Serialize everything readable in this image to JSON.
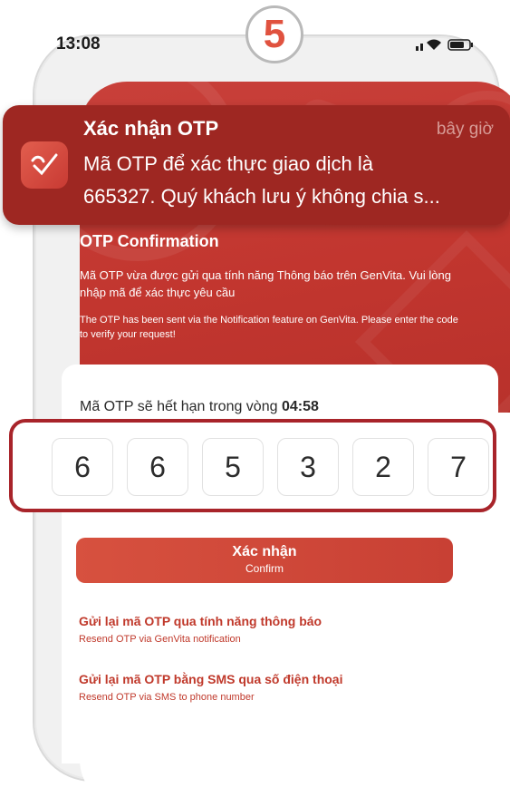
{
  "step_badge": "5",
  "status_bar": {
    "time": "13:08",
    "icons": "… ▲ ▮"
  },
  "notification": {
    "app_icon": "genvita-heart-icon",
    "title": "Xác nhận OTP",
    "time": "bây giờ",
    "body_line1": "Mã OTP để xác thực giao dịch là",
    "body_line2": "665327. Quý khách lưu ý không chia s..."
  },
  "header": {
    "title": "OTP Confirmation",
    "desc_vi": "Mã OTP vừa được gửi qua tính năng Thông báo trên GenVita. Vui lòng nhập mã để xác thực yêu cầu",
    "desc_en": "The OTP has been sent via the Notification feature on GenVita. Please enter the code to verify your request!"
  },
  "expiry": {
    "label": "Mã OTP sẽ hết hạn trong vòng ",
    "countdown": "04:58"
  },
  "otp_digits": [
    "6",
    "6",
    "5",
    "3",
    "2",
    "7"
  ],
  "confirm_button": {
    "label_vi": "Xác nhận",
    "label_en": "Confirm"
  },
  "resend_notification": {
    "label_vi": "Gửi lại mã OTP qua tính năng thông báo",
    "label_en": "Resend OTP via GenVita notification"
  },
  "resend_sms": {
    "label_vi": "Gửi lại mã OTP bằng SMS qua số điện thoại",
    "label_en": "Resend OTP via SMS to phone number"
  },
  "colors": {
    "brand_red": "#c8403a",
    "highlight_border": "#a8242a",
    "notification_bg": "#9e2722"
  }
}
